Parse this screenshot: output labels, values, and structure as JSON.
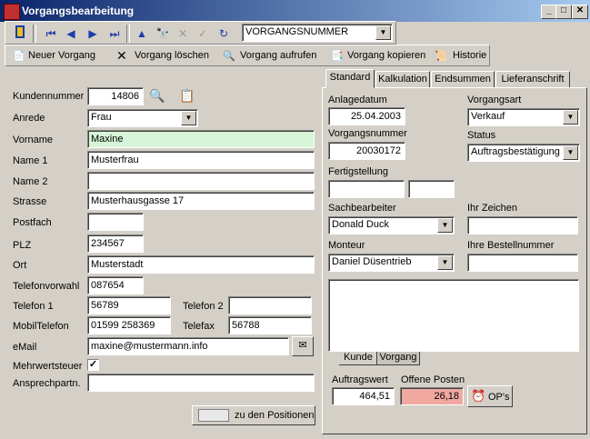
{
  "window": {
    "title": "Vorgangsbearbeitung",
    "min": "_",
    "max": "□",
    "close": "✕"
  },
  "nav": {
    "record_selector": "VORGANGSNUMMER"
  },
  "actions": {
    "new": "Neuer Vorgang",
    "delete": "Vorgang löschen",
    "open": "Vorgang aufrufen",
    "copy": "Vorgang kopieren",
    "history": "Historie"
  },
  "customer": {
    "kundennummer_label": "Kundennummer",
    "kundennummer": "14806",
    "anrede_label": "Anrede",
    "anrede": "Frau",
    "vorname_label": "Vorname",
    "vorname": "Maxine",
    "name1_label": "Name 1",
    "name1": "Musterfrau",
    "name2_label": "Name 2",
    "name2": "",
    "strasse_label": "Strasse",
    "strasse": "Musterhausgasse 17",
    "postfach_label": "Postfach",
    "postfach": "",
    "plz_label": "PLZ",
    "plz": "234567",
    "ort_label": "Ort",
    "ort": "Musterstadt",
    "telefonvorwahl_label": "Telefonvorwahl",
    "telefonvorwahl": "087654",
    "telefon1_label": "Telefon 1",
    "telefon1": "56789",
    "telefon2_label": "Telefon 2",
    "telefon2": "",
    "mobil_label": "MobilTelefon",
    "mobil": "01599 258369",
    "telefax_label": "Telefax",
    "telefax": "56788",
    "email_label": "eMail",
    "email": "maxine@mustermann.info",
    "mwst_label": "Mehrwertsteuer",
    "mwst_checked": true,
    "ansprech_label": "Ansprechpartn.",
    "ansprech": "",
    "positions_button": "zu den Positionen"
  },
  "tabs": [
    "Standard",
    "Kalkulation",
    "Endsummen",
    "Lieferanschrift"
  ],
  "standard": {
    "anlagedatum_label": "Anlagedatum",
    "anlagedatum": "25.04.2003",
    "vorgangsart_label": "Vorgangsart",
    "vorgangsart": "Verkauf",
    "vorgangsnummer_label": "Vorgangsnummer",
    "vorgangsnummer": "20030172",
    "status_label": "Status",
    "status": "Auftragsbestätigung",
    "fertigstellung_label": "Fertigstellung",
    "fertigstellung1": "",
    "fertigstellung2": "",
    "sachbearbeiter_label": "Sachbearbeiter",
    "sachbearbeiter": "Donald Duck",
    "ihr_zeichen_label": "Ihr Zeichen",
    "ihr_zeichen": "",
    "monteur_label": "Monteur",
    "monteur": "Daniel Düsentrieb",
    "bestellnummer_label": "Ihre Bestellnummer",
    "bestellnummer": "",
    "subtabs": [
      "Kunde",
      "Vorgang"
    ],
    "auftragswert_label": "Auftragswert",
    "auftragswert": "464,51",
    "offene_posten_label": "Offene Posten",
    "offene_posten": "26,18",
    "ops_button": "OP's"
  },
  "colors": {
    "vorname_bg": "#d6f5d6",
    "offene_posten_bg": "#f0a8a0",
    "titlebar": "#0a246a"
  }
}
